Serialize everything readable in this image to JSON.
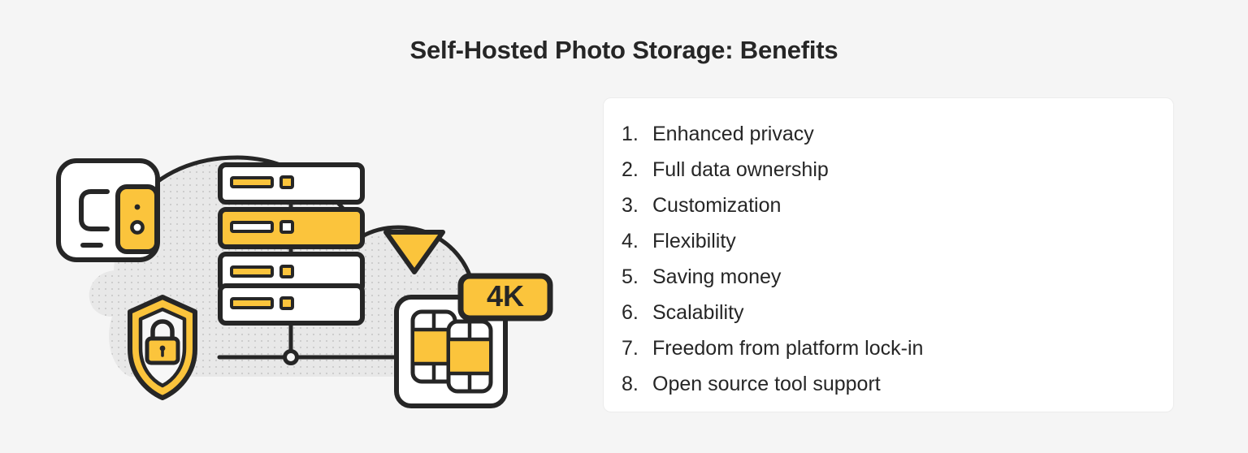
{
  "page": {
    "title": "Self-Hosted Photo Storage: Benefits",
    "background_color": "#f5f5f5",
    "text_color": "#262626",
    "accent_color": "#fbc43c",
    "outline_color": "#262626",
    "cloud_fill": "#e8e8e8",
    "card_background": "#ffffff",
    "card_border_color": "#ececec"
  },
  "benefits": {
    "items": [
      {
        "index": "1.",
        "label": "Enhanced privacy"
      },
      {
        "index": "2.",
        "label": "Full data ownership"
      },
      {
        "index": "3.",
        "label": "Customization"
      },
      {
        "index": "4.",
        "label": "Flexibility"
      },
      {
        "index": "5.",
        "label": "Saving money"
      },
      {
        "index": "6.",
        "label": "Scalability"
      },
      {
        "index": "7.",
        "label": "Freedom from platform lock-in"
      },
      {
        "index": "8.",
        "label": "Open source tool support"
      }
    ]
  },
  "illustration": {
    "cloud_icon": "cloud-shape",
    "computer_icon": "computer-device-icon",
    "server_icon": "server-stack-icon",
    "server_units": 4,
    "highlighted_server_unit": 2,
    "shield_icon": "shield-lock-icon",
    "play_icon": "play-triangle-icon",
    "media_card_icon": "film-strip-card-icon",
    "quality_badge": "4K"
  }
}
